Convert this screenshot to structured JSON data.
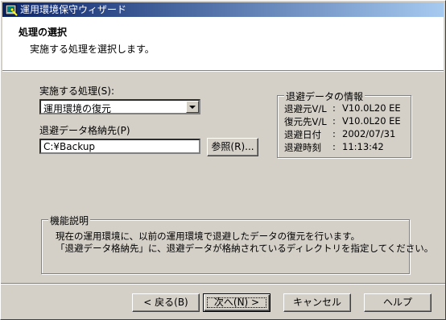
{
  "window": {
    "title": "運用環境保守ウィザード",
    "icon": "wizard-app-icon"
  },
  "header": {
    "title": "処理の選択",
    "subtitle": "実施する処理を選択します。"
  },
  "process": {
    "label": "実施する処理(S):",
    "selected": "運用環境の復元"
  },
  "backup_dest": {
    "label": "退避データ格納先(P)",
    "value": "C:¥Backup",
    "browse_label": "参照(R)..."
  },
  "info": {
    "legend": "退避データの情報",
    "rows": [
      {
        "label": "退避元V/L",
        "sep": ":",
        "value": "V10.0L20 EE"
      },
      {
        "label": "復元先V/L",
        "sep": ":",
        "value": "V10.0L20 EE"
      },
      {
        "label": "退避日付",
        "sep": ":",
        "value": "2002/07/31"
      },
      {
        "label": "退避時刻",
        "sep": ":",
        "value": "11:13:42"
      }
    ]
  },
  "description": {
    "legend": "機能説明",
    "line1": "現在の運用環境に、以前の運用環境で退避したデータの復元を行います。",
    "line2": "「退避データ格納先」に、退避データが格納されているディレクトリを指定してください。"
  },
  "buttons": {
    "back": "< 戻る(B)",
    "next": "次へ(N) >",
    "cancel": "キャンセル",
    "help": "ヘルプ"
  }
}
